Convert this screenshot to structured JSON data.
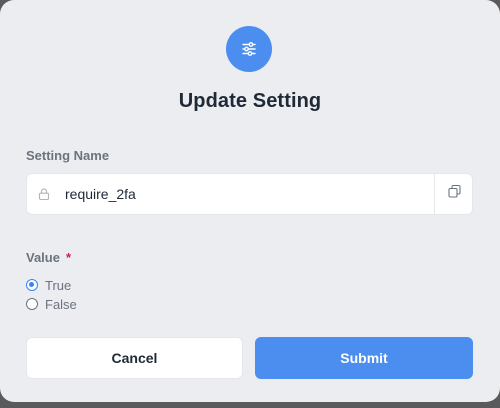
{
  "dialog": {
    "title": "Update Setting",
    "header_icon": "sliders-icon",
    "accent_color": "#4b8ef0"
  },
  "setting_name": {
    "label": "Setting Name",
    "value": "require_2fa",
    "lock_icon": "lock-icon",
    "copy_icon": "copy-icon"
  },
  "value_field": {
    "label": "Value",
    "required_marker": "*",
    "options": [
      {
        "label": "True",
        "checked": true
      },
      {
        "label": "False",
        "checked": false
      }
    ]
  },
  "actions": {
    "cancel_label": "Cancel",
    "submit_label": "Submit"
  }
}
